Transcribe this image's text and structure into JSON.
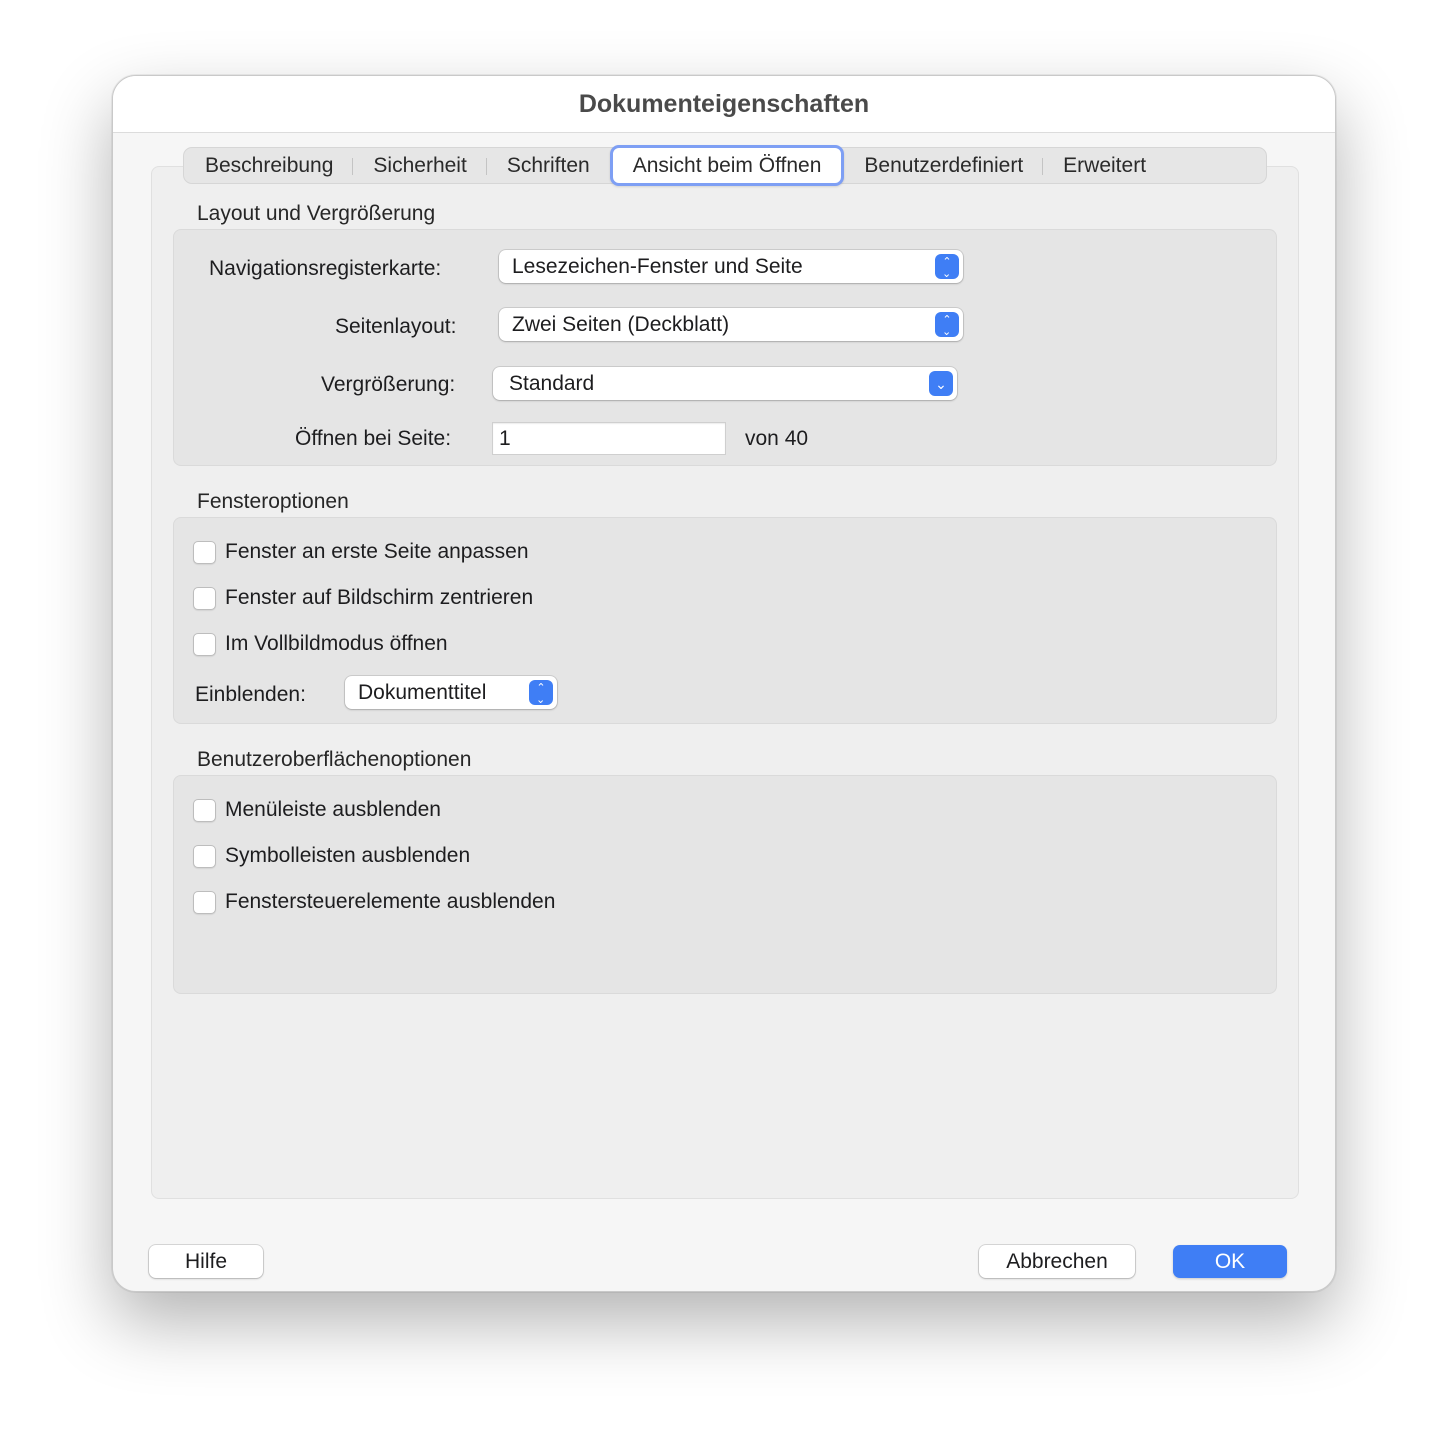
{
  "window": {
    "title": "Dokumenteigenschaften"
  },
  "tabs": [
    {
      "label": "Beschreibung"
    },
    {
      "label": "Sicherheit"
    },
    {
      "label": "Schriften"
    },
    {
      "label": "Ansicht beim Öffnen",
      "active": true
    },
    {
      "label": "Benutzerdefiniert"
    },
    {
      "label": "Erweitert"
    }
  ],
  "layout_section": {
    "label": "Layout und Vergrößerung",
    "navigation_tab": {
      "label": "Navigationsregisterkarte:",
      "value": "Lesezeichen-Fenster und Seite"
    },
    "page_layout": {
      "label": "Seitenlayout:",
      "value": "Zwei Seiten (Deckblatt)"
    },
    "magnification": {
      "label": "Vergrößerung:",
      "value": "Standard"
    },
    "open_at_page": {
      "label": "Öffnen bei Seite:",
      "value": "1",
      "of_label": "von 40"
    }
  },
  "window_section": {
    "label": "Fensteroptionen",
    "checkboxes": [
      {
        "label": "Fenster an erste Seite anpassen",
        "checked": false
      },
      {
        "label": "Fenster auf Bildschirm zentrieren",
        "checked": false
      },
      {
        "label": "Im Vollbildmodus öffnen",
        "checked": false
      }
    ],
    "show": {
      "label": "Einblenden:",
      "value": "Dokumenttitel"
    }
  },
  "ui_section": {
    "label": "Benutzeroberflächenoptionen",
    "checkboxes": [
      {
        "label": "Menüleiste ausblenden",
        "checked": false
      },
      {
        "label": "Symbolleisten ausblenden",
        "checked": false
      },
      {
        "label": "Fenstersteuerelemente ausblenden",
        "checked": false
      }
    ]
  },
  "buttons": {
    "help": "Hilfe",
    "cancel": "Abbrechen",
    "ok": "OK"
  },
  "colors": {
    "accent": "#3f7ef5",
    "focus_ring": "#7e9ff4"
  }
}
